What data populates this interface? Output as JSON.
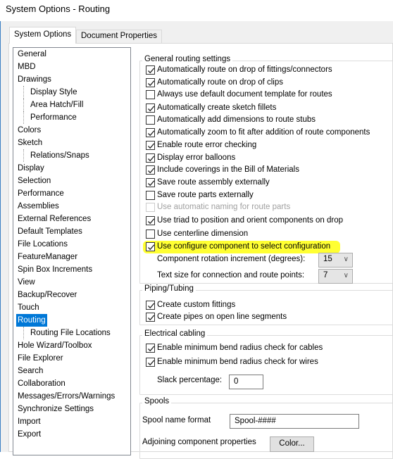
{
  "window": {
    "title": "System Options - Routing"
  },
  "tabs": [
    {
      "label": "System Options",
      "active": true
    },
    {
      "label": "Document Properties",
      "active": false
    }
  ],
  "tree": {
    "selected": "Routing",
    "items": [
      {
        "label": "General",
        "level": 0
      },
      {
        "label": "MBD",
        "level": 0
      },
      {
        "label": "Drawings",
        "level": 0
      },
      {
        "label": "Display Style",
        "level": 1
      },
      {
        "label": "Area Hatch/Fill",
        "level": 1
      },
      {
        "label": "Performance",
        "level": 1
      },
      {
        "label": "Colors",
        "level": 0
      },
      {
        "label": "Sketch",
        "level": 0
      },
      {
        "label": "Relations/Snaps",
        "level": 1
      },
      {
        "label": "Display",
        "level": 0
      },
      {
        "label": "Selection",
        "level": 0
      },
      {
        "label": "Performance",
        "level": 0
      },
      {
        "label": "Assemblies",
        "level": 0
      },
      {
        "label": "External References",
        "level": 0
      },
      {
        "label": "Default Templates",
        "level": 0
      },
      {
        "label": "File Locations",
        "level": 0
      },
      {
        "label": "FeatureManager",
        "level": 0
      },
      {
        "label": "Spin Box Increments",
        "level": 0
      },
      {
        "label": "View",
        "level": 0
      },
      {
        "label": "Backup/Recover",
        "level": 0
      },
      {
        "label": "Touch",
        "level": 0
      },
      {
        "label": "Routing",
        "level": 0,
        "selected": true
      },
      {
        "label": "Routing File Locations",
        "level": 1
      },
      {
        "label": "Hole Wizard/Toolbox",
        "level": 0
      },
      {
        "label": "File Explorer",
        "level": 0
      },
      {
        "label": "Search",
        "level": 0
      },
      {
        "label": "Collaboration",
        "level": 0
      },
      {
        "label": "Messages/Errors/Warnings",
        "level": 0
      },
      {
        "label": "Synchronize Settings",
        "level": 0
      },
      {
        "label": "Import",
        "level": 0
      },
      {
        "label": "Export",
        "level": 0
      }
    ]
  },
  "general": {
    "label": "General routing settings",
    "checkboxes": [
      {
        "label": "Automatically route on drop of fittings/connectors",
        "checked": true
      },
      {
        "label": "Automatically route on drop of clips",
        "checked": true
      },
      {
        "label": "Always use default document template for routes",
        "checked": false
      },
      {
        "label": "Automatically create sketch fillets",
        "checked": true
      },
      {
        "label": "Automatically add dimensions to route stubs",
        "checked": false
      },
      {
        "label": "Automatically zoom to fit after addition of route components",
        "checked": true
      },
      {
        "label": "Enable route error checking",
        "checked": true
      },
      {
        "label": "Display error balloons",
        "checked": true
      },
      {
        "label": "Include coverings in the Bill of Materials",
        "checked": true
      },
      {
        "label": "Save route assembly externally",
        "checked": true
      },
      {
        "label": "Save route parts externally",
        "checked": false
      },
      {
        "label": "Use automatic naming for route parts",
        "checked": false,
        "disabled": true
      },
      {
        "label": "Use triad to position and orient components on drop",
        "checked": true
      },
      {
        "label": "Use centerline dimension",
        "checked": false
      },
      {
        "label": "Use configure component to select configuration",
        "checked": true,
        "highlighted": true
      }
    ],
    "rotation": {
      "label": "Component rotation increment (degrees):",
      "value": "15"
    },
    "textsize": {
      "label": "Text size for connection and route points:",
      "value": "7"
    }
  },
  "piping": {
    "label": "Piping/Tubing",
    "checkboxes": [
      {
        "label": "Create custom fittings",
        "checked": true
      },
      {
        "label": "Create pipes on open line segments",
        "checked": true
      }
    ]
  },
  "electrical": {
    "label": "Electrical cabling",
    "checkboxes": [
      {
        "label": "Enable minimum bend radius check for cables",
        "checked": true
      },
      {
        "label": "Enable minimum bend radius check for wires",
        "checked": true
      }
    ],
    "slack": {
      "label": "Slack percentage:",
      "value": "0"
    }
  },
  "spools": {
    "label": "Spools",
    "name_format": {
      "label": "Spool name format",
      "value": "Spool-####"
    },
    "adjoining": {
      "label": "Adjoining component properties",
      "button": "Color..."
    }
  },
  "colors": {
    "highlight": "#ffff33",
    "selection": "#0078d7"
  }
}
